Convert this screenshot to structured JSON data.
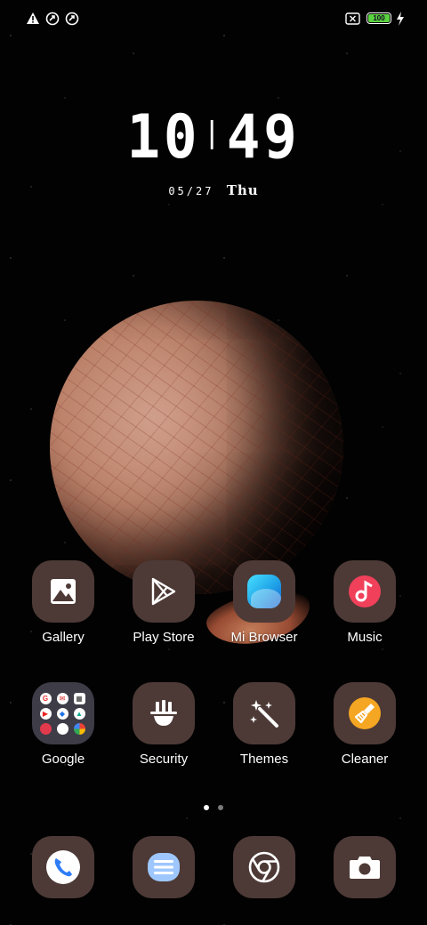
{
  "status_bar": {
    "left_icons": [
      "warning-icon",
      "sync-icon",
      "sync-icon"
    ],
    "battery_level": "100",
    "charging": true
  },
  "lockscreen": {
    "hour": "10",
    "minute": "49",
    "date": "05/27",
    "weekday": "Thu"
  },
  "apps": [
    {
      "label": "Gallery",
      "icon": "gallery-icon"
    },
    {
      "label": "Play Store",
      "icon": "play-store-icon"
    },
    {
      "label": "Mi Browser",
      "icon": "mi-browser-icon"
    },
    {
      "label": "Music",
      "icon": "music-icon"
    },
    {
      "label": "Google",
      "icon": "google-folder-icon"
    },
    {
      "label": "Security",
      "icon": "security-icon"
    },
    {
      "label": "Themes",
      "icon": "themes-icon"
    },
    {
      "label": "Cleaner",
      "icon": "cleaner-icon"
    }
  ],
  "page_indicator": {
    "pages": 2,
    "current": 1
  },
  "dock": [
    {
      "icon": "phone-icon"
    },
    {
      "icon": "messages-icon"
    },
    {
      "icon": "chrome-icon"
    },
    {
      "icon": "camera-icon"
    }
  ],
  "colors": {
    "icon_bg": "#4d3a36",
    "battery_green": "#5ad340",
    "browser_blue": "#1fa3e8",
    "music_red": "#f0405a",
    "cleaner_orange": "#f5a623",
    "phone_blue": "#2e7cf6"
  }
}
